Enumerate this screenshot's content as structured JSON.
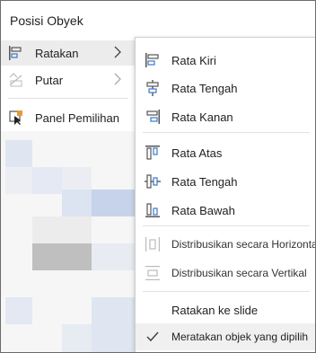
{
  "menu": {
    "title": "Posisi Obyek",
    "items": [
      {
        "label": "Ratakan",
        "icon": "align-icon",
        "has_submenu": true
      },
      {
        "label": "Putar",
        "icon": "rotate-icon",
        "has_submenu": true
      },
      {
        "label": "Panel Pemilihan",
        "icon": "selection-pane-icon",
        "has_submenu": false
      }
    ]
  },
  "submenu": {
    "items": [
      {
        "label": "Rata Kiri",
        "icon": "align-left-icon"
      },
      {
        "label": "Rata Tengah",
        "icon": "align-center-icon"
      },
      {
        "label": "Rata Kanan",
        "icon": "align-right-icon"
      },
      {
        "label": "Rata Atas",
        "icon": "align-top-icon"
      },
      {
        "label": "Rata Tengah",
        "icon": "align-middle-icon"
      },
      {
        "label": "Rata Bawah",
        "icon": "align-bottom-icon"
      },
      {
        "label": "Distribusikan secara Horizontal",
        "icon": "distribute-horizontal-icon"
      },
      {
        "label": "Distribusikan secara Vertikal",
        "icon": "distribute-vertical-icon"
      },
      {
        "label": "Ratakan ke slide",
        "icon": ""
      },
      {
        "label": "Meratakan objek yang dipilih",
        "icon": "check-icon",
        "checked": true
      }
    ]
  },
  "colors": {
    "accent": "#2b6cb0",
    "icon_blue": "#3a78c9",
    "mosaic_light": "#dbe3f1",
    "mosaic_mid": "#c4d1ea",
    "mosaic_gray": "#bdbdbd"
  }
}
